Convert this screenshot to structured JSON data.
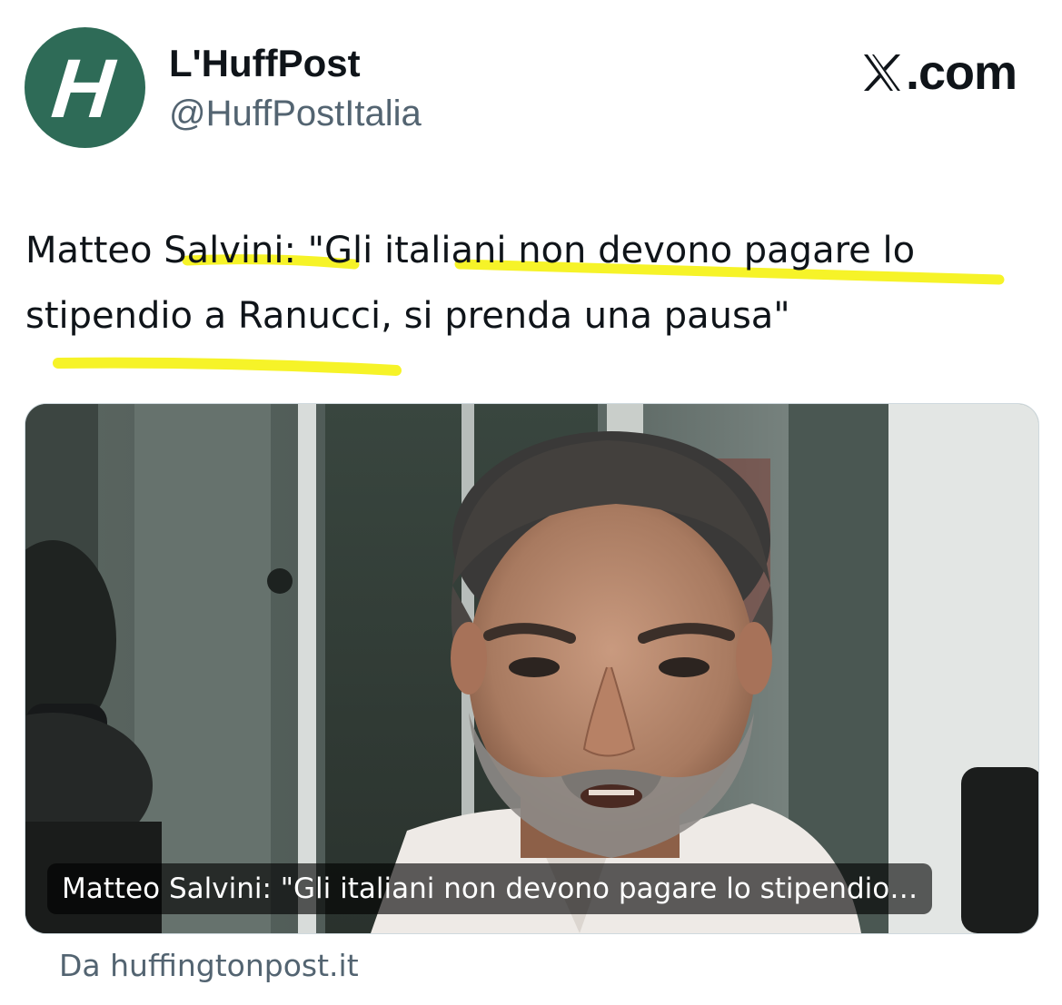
{
  "account": {
    "display_name": "L'HuffPost",
    "handle": "@HuffPostItalia",
    "avatar_letter": "H",
    "avatar_color": "#2e6b57"
  },
  "brand": {
    "text": ".com",
    "logo_icon": "x-logo-icon"
  },
  "tweet": {
    "text": "Matteo Salvini: \"Gli italiani non devono pagare lo stipendio a Ranucci, si prenda una pausa\"",
    "highlight_color": "#f5f216"
  },
  "link_card": {
    "image_icon": "photo-matteo-salvini",
    "caption": "Matteo Salvini: \"Gli italiani non devono pagare lo stipendio…",
    "source": "Da huffingtonpost.it"
  }
}
